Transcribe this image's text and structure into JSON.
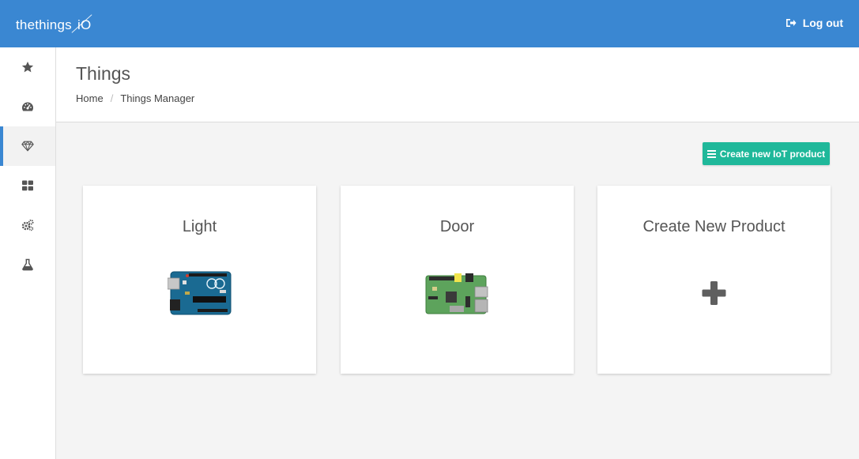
{
  "app": {
    "logo_text": "thethings iO",
    "logout_label": "Log out"
  },
  "sidebar": {
    "items": [
      {
        "icon": "star-icon",
        "active": false
      },
      {
        "icon": "dashboard-icon",
        "active": false
      },
      {
        "icon": "diamond-icon",
        "active": true
      },
      {
        "icon": "grid-icon",
        "active": false
      },
      {
        "icon": "gears-icon",
        "active": false
      },
      {
        "icon": "flask-icon",
        "active": false
      }
    ]
  },
  "header": {
    "title": "Things",
    "breadcrumb": [
      "Home",
      "Things Manager"
    ]
  },
  "toolbar": {
    "create_label": "Create new IoT product"
  },
  "products": [
    {
      "name": "Light",
      "image": "arduino-board"
    },
    {
      "name": "Door",
      "image": "raspberry-pi-board"
    },
    {
      "name": "Create New Product",
      "image": "plus-icon"
    }
  ],
  "colors": {
    "topbar": "#3a87d2",
    "accent": "#1fb89a",
    "active_indicator": "#3a87d2"
  }
}
